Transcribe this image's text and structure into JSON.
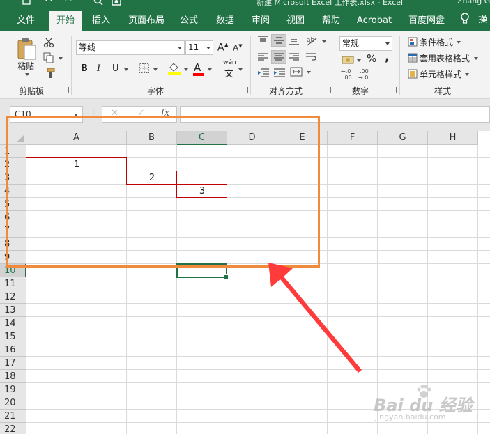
{
  "title_bar": {
    "quick_access": [
      "save-icon",
      "undo-icon",
      "redo-icon",
      "print-preview-icon"
    ],
    "title": "新建 Microsoft Excel 工作表.xlsx  -  Excel",
    "user": "Zhang G"
  },
  "ribbon_tabs": [
    {
      "label": "文件",
      "active": false
    },
    {
      "label": "开始",
      "active": true
    },
    {
      "label": "插入",
      "active": false
    },
    {
      "label": "页面布局",
      "active": false
    },
    {
      "label": "公式",
      "active": false
    },
    {
      "label": "数据",
      "active": false
    },
    {
      "label": "审阅",
      "active": false
    },
    {
      "label": "视图",
      "active": false
    },
    {
      "label": "帮助",
      "active": false
    },
    {
      "label": "Acrobat",
      "active": false
    },
    {
      "label": "百度网盘",
      "active": false
    }
  ],
  "tell_me": {
    "icon": "lightbulb-icon",
    "label": "操"
  },
  "clipboard": {
    "paste_label": "粘贴",
    "group_label": "剪贴板",
    "icons": [
      "cut-icon",
      "copy-icon",
      "format-painter-icon"
    ]
  },
  "font": {
    "font_name": "等线",
    "font_size": "11",
    "group_label": "字体",
    "bold": "B",
    "italic": "I",
    "underline": "U",
    "grow_label": "A",
    "shrink_label": "A",
    "font_color_label": "A",
    "phonetic_label": "wén",
    "phonetic_char": "文",
    "colors": {
      "fill": "#ffff00",
      "font": "#ff0000"
    }
  },
  "alignment": {
    "group_label": "对齐方式"
  },
  "number": {
    "format": "常规",
    "group_label": "数字",
    "percent": "%",
    "comma": ",",
    "increase_decimal": ".0→.00",
    "decrease_decimal": ".00→.0"
  },
  "styles": {
    "conditional": "条件格式",
    "table": "套用表格格式",
    "cell": "单元格样式",
    "group_label": "样式"
  },
  "formula_bar": {
    "name_box": "C10",
    "dots": "⋮",
    "cancel": "✕",
    "enter": "✓",
    "fx": "fx",
    "value": ""
  },
  "sheet": {
    "columns": [
      "A",
      "B",
      "C",
      "D",
      "E",
      "F",
      "G",
      "H"
    ],
    "rows": [
      "1",
      "2",
      "3",
      "4",
      "5",
      "6",
      "7",
      "8",
      "9",
      "10",
      "11",
      "12",
      "13",
      "14",
      "15",
      "16",
      "17",
      "18",
      "19",
      "20",
      "21",
      "22"
    ],
    "selected_column": "C",
    "selected_row": "10",
    "cells": [
      {
        "ref": "A2",
        "value": "1"
      },
      {
        "ref": "B3",
        "value": "2"
      },
      {
        "ref": "C4",
        "value": "3"
      }
    ]
  },
  "watermark": {
    "big": "Bai du 经验",
    "small": "jingyan.baidu.com"
  },
  "colors": {
    "accent": "#217346",
    "highlight_box": "#f08a3c",
    "arrow": "#ff3b3b",
    "cell_border": "#c00000"
  }
}
